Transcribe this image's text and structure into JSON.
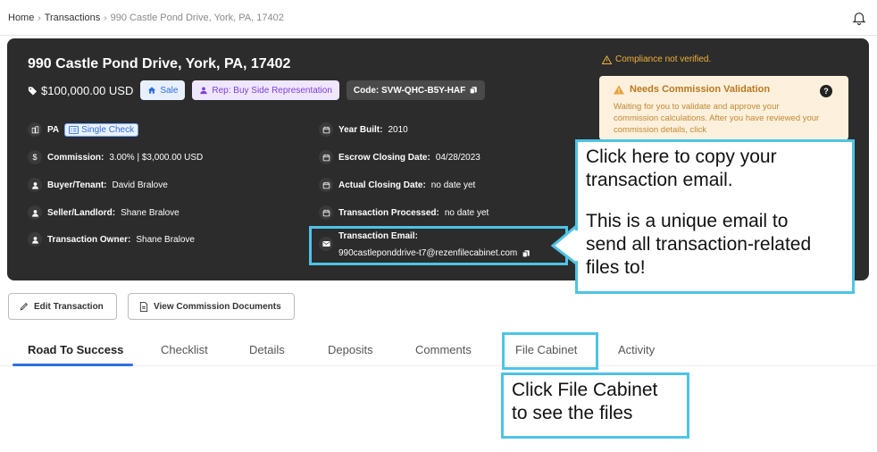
{
  "breadcrumb": {
    "home": "Home",
    "transactions": "Transactions",
    "current": "990 Castle Pond Drive, York, PA, 17402"
  },
  "icons": {
    "bell": "bell-icon",
    "tag": "price-tag-icon",
    "home": "home-icon",
    "user": "user-icon",
    "copy": "copy-icon",
    "building": "building-icon",
    "dollar": "dollar-icon",
    "calendar": "calendar-icon",
    "mail": "mail-icon",
    "warning": "warning-icon",
    "edit": "pencil-icon",
    "document": "document-icon"
  },
  "colors": {
    "card_bg": "#2c2c2c",
    "accent": "#2f6fde",
    "warning": "#f3b13a",
    "highlight": "#4ec3e6"
  },
  "header": {
    "address": "990 Castle Pond Drive, York, PA, 17402",
    "price": "$100,000.00 USD",
    "sale_chip": "Sale",
    "rep_chip": "Rep: Buy Side Representation",
    "code_chip": "Code: SVW-QHC-B5Y-HAF"
  },
  "details_left": {
    "state": "PA",
    "single_check": "Single Check",
    "commission_label": "Commission:",
    "commission_value": "3.00% | $3,000.00 USD",
    "buyer_label": "Buyer/Tenant:",
    "buyer_value": "David Bralove",
    "seller_label": "Seller/Landlord:",
    "seller_value": "Shane Bralove",
    "owner_label": "Transaction Owner:",
    "owner_value": "Shane Bralove"
  },
  "details_right": {
    "year_label": "Year Built:",
    "year_value": "2010",
    "escrow_label": "Escrow Closing Date:",
    "escrow_value": "04/28/2023",
    "actual_label": "Actual Closing Date:",
    "actual_value": "no date yet",
    "processed_label": "Transaction Processed:",
    "processed_value": "no date yet",
    "email_label": "Transaction Email:",
    "email_value": "990castleponddrive-t7@rezenfilecabinet.com"
  },
  "compliance": {
    "status": "Compliance not verified.",
    "validation_title": "Needs Commission Validation",
    "validation_body": "Waiting for you to validate and approve your commission calculations. After you have reviewed your commission details, click"
  },
  "actions": {
    "edit": "Edit Transaction",
    "view_docs": "View Commission Documents"
  },
  "tabs": [
    "Road To Success",
    "Checklist",
    "Details",
    "Deposits",
    "Comments",
    "File Cabinet",
    "Activity"
  ],
  "callouts": {
    "email_line1": "Click here to copy your",
    "email_line2": "transaction email.",
    "email_line3": "This is a unique email to",
    "email_line4": "send all transaction-related",
    "email_line5": "files to!",
    "cabinet_line1": "Click File Cabinet",
    "cabinet_line2": "to see the files"
  }
}
